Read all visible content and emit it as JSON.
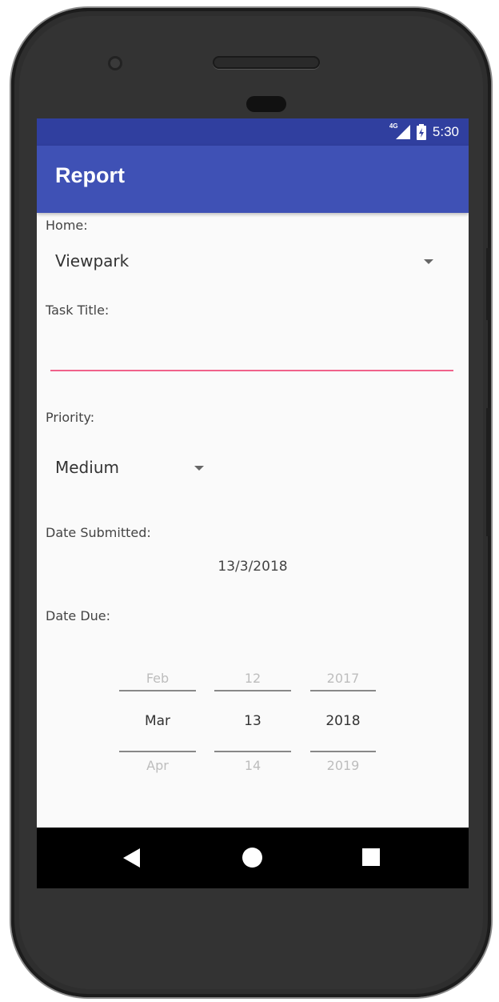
{
  "status_bar": {
    "network_label": "4G",
    "time": "5:30",
    "color": "#303f9f"
  },
  "app_bar": {
    "title": "Report",
    "color": "#3f51b5"
  },
  "form": {
    "home_label": "Home:",
    "home_value": "Viewpark",
    "task_title_label": "Task Title:",
    "task_title_value": "",
    "priority_label": "Priority:",
    "priority_value": "Medium",
    "date_submitted_label": "Date Submitted:",
    "date_submitted_value": "13/3/2018",
    "date_due_label": "Date Due:"
  },
  "date_picker": {
    "month": {
      "prev": "Feb",
      "current": "Mar",
      "next": "Apr"
    },
    "day": {
      "prev": "12",
      "current": "13",
      "next": "14"
    },
    "year": {
      "prev": "2017",
      "current": "2018",
      "next": "2019"
    }
  },
  "accent_color": "#f0628a",
  "icons": {
    "signal": "signal-icon",
    "battery": "battery-icon",
    "back": "back-icon",
    "home": "home-icon",
    "recents": "recents-icon",
    "dropdown": "chevron-down-icon"
  }
}
